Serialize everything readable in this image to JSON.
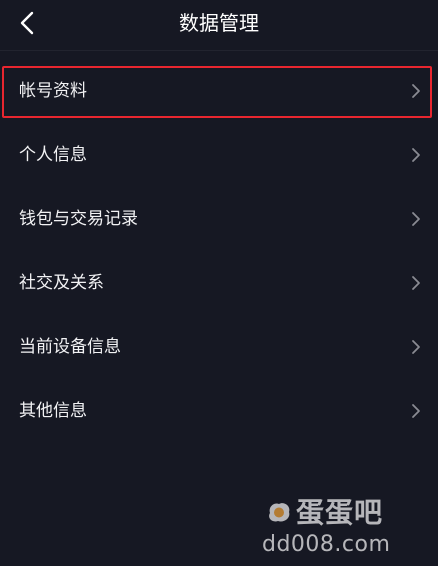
{
  "header": {
    "title": "数据管理",
    "back_icon": "chevron-left-icon"
  },
  "menu": {
    "items": [
      {
        "label": "帐号资料",
        "icon": "chevron-right-icon",
        "highlighted": true
      },
      {
        "label": "个人信息",
        "icon": "chevron-right-icon"
      },
      {
        "label": "钱包与交易记录",
        "icon": "chevron-right-icon"
      },
      {
        "label": "社交及关系",
        "icon": "chevron-right-icon"
      },
      {
        "label": "当前设备信息",
        "icon": "chevron-right-icon"
      },
      {
        "label": "其他信息",
        "icon": "chevron-right-icon"
      }
    ]
  },
  "watermark": {
    "brand": "蛋蛋吧",
    "url": "dd008.com",
    "icon": "fried-egg-icon"
  },
  "colors": {
    "background": "#161823",
    "text": "#ffffff",
    "chevron": "#8a8b93",
    "highlight": "#e8262f"
  }
}
